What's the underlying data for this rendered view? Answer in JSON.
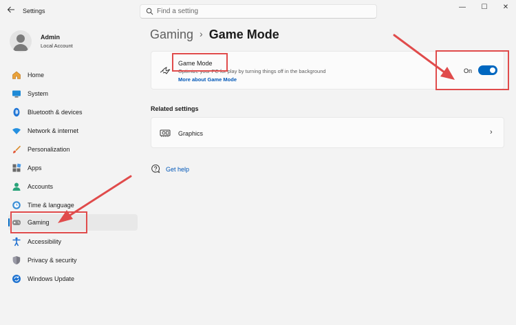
{
  "window": {
    "title": "Settings",
    "controls": {
      "minimize": "—",
      "maximize": "☐",
      "close": "✕"
    }
  },
  "search": {
    "placeholder": "Find a setting"
  },
  "profile": {
    "name": "Admin",
    "account_type": "Local Account"
  },
  "sidebar": {
    "items": [
      {
        "label": "Home",
        "icon": "home-icon"
      },
      {
        "label": "System",
        "icon": "monitor-icon"
      },
      {
        "label": "Bluetooth & devices",
        "icon": "bluetooth-icon"
      },
      {
        "label": "Network & internet",
        "icon": "wifi-icon"
      },
      {
        "label": "Personalization",
        "icon": "brush-icon"
      },
      {
        "label": "Apps",
        "icon": "apps-icon"
      },
      {
        "label": "Accounts",
        "icon": "person-icon"
      },
      {
        "label": "Time & language",
        "icon": "globe-clock-icon"
      },
      {
        "label": "Gaming",
        "icon": "gamepad-icon",
        "active": true
      },
      {
        "label": "Accessibility",
        "icon": "accessibility-icon"
      },
      {
        "label": "Privacy & security",
        "icon": "shield-icon"
      },
      {
        "label": "Windows Update",
        "icon": "update-icon"
      }
    ]
  },
  "breadcrumb": {
    "parent": "Gaming",
    "separator": "›",
    "current": "Game Mode"
  },
  "game_mode": {
    "title": "Game Mode",
    "description": "Optimize your PC for play by turning things off in the background",
    "link": "More about Game Mode",
    "toggle_state": "On",
    "toggle_on": true
  },
  "related": {
    "heading": "Related settings",
    "items": [
      {
        "label": "Graphics",
        "chevron": "›"
      }
    ]
  },
  "help": {
    "label": "Get help"
  },
  "colors": {
    "accent": "#0067c0",
    "annotation": "#e04b4b",
    "background": "#f3f3f3",
    "card": "#fbfbfb"
  }
}
